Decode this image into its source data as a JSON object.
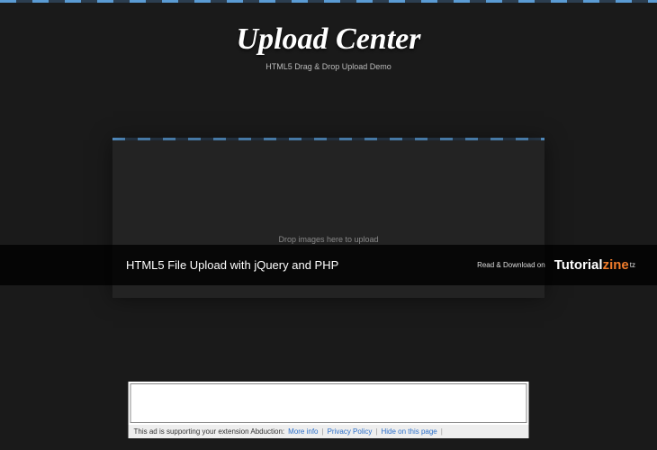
{
  "header": {
    "title": "Upload Center",
    "subtitle": "HTML5 Drag & Drop Upload Demo"
  },
  "dropbox": {
    "instruction": "Drop images here to upload"
  },
  "overlay": {
    "article_title": "HTML5 File Upload with jQuery and PHP",
    "cta": "Read & Download on",
    "brand_a": "Tutorial",
    "brand_b": "zine",
    "brand_sup": "tz"
  },
  "ad": {
    "prefix": "This ad is supporting your extension Abduction:",
    "more_info": "More info",
    "privacy": "Privacy Policy",
    "hide": "Hide on this page",
    "sep": "|"
  }
}
